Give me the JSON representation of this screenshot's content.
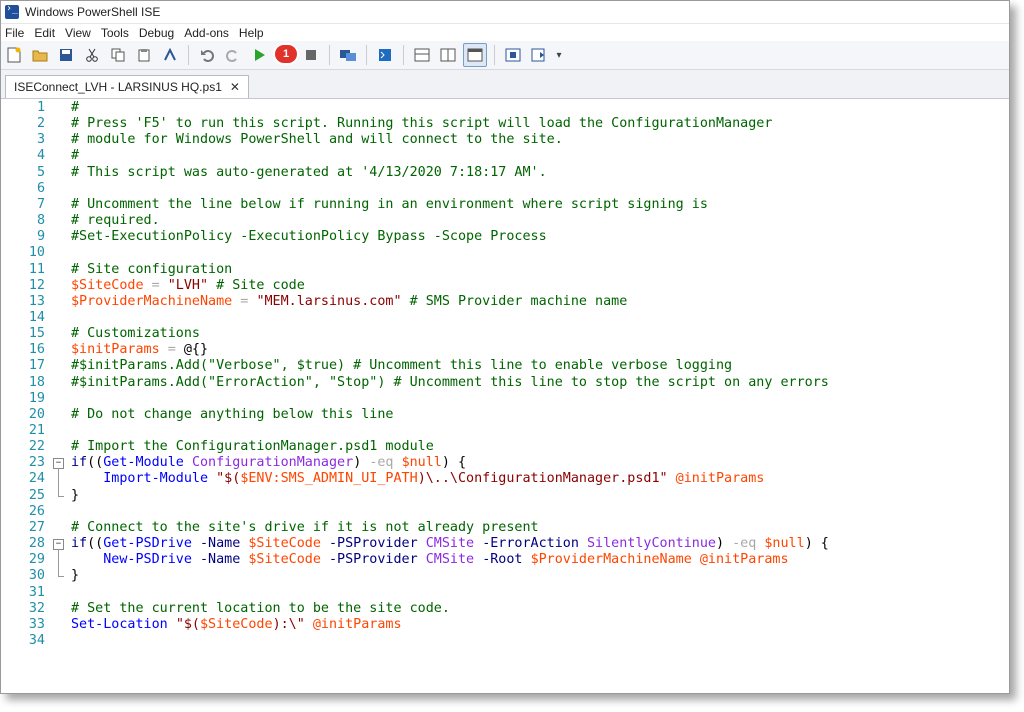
{
  "window": {
    "title": "Windows PowerShell ISE"
  },
  "menu": [
    "File",
    "Edit",
    "View",
    "Tools",
    "Debug",
    "Add-ons",
    "Help"
  ],
  "toolbar": {
    "icons": [
      "new-file-icon",
      "open-folder-icon",
      "save-icon",
      "cut-icon",
      "copy-icon",
      "paste-icon",
      "clear-icon",
      "undo-icon",
      "redo-icon",
      "run-script-icon",
      "run-selection-icon",
      "stop-icon",
      "remote-powershell-icon",
      "console-icon",
      "show-script-top-icon",
      "show-script-right-icon",
      "show-script-max-icon",
      "show-addon-icon",
      "show-addon-tools-icon"
    ],
    "badge": "1"
  },
  "tab": {
    "label": "ISEConnect_LVH - LARSINUS HQ.ps1",
    "close": "✕"
  },
  "code_lines": [
    [
      [
        "c-comment",
        "#"
      ]
    ],
    [
      [
        "c-comment",
        "# Press 'F5' to run this script. Running this script will load the ConfigurationManager"
      ]
    ],
    [
      [
        "c-comment",
        "# module for Windows PowerShell and will connect to the site."
      ]
    ],
    [
      [
        "c-comment",
        "#"
      ]
    ],
    [
      [
        "c-comment",
        "# This script was auto-generated at '4/13/2020 7:18:17 AM'."
      ]
    ],
    [],
    [
      [
        "c-comment",
        "# Uncomment the line below if running in an environment where script signing is"
      ]
    ],
    [
      [
        "c-comment",
        "# required."
      ]
    ],
    [
      [
        "c-comment",
        "#Set-ExecutionPolicy -ExecutionPolicy Bypass -Scope Process"
      ]
    ],
    [],
    [
      [
        "c-comment",
        "# Site configuration"
      ]
    ],
    [
      [
        "c-var",
        "$SiteCode"
      ],
      [
        "c-op",
        " = "
      ],
      [
        "c-str",
        "\"LVH\""
      ],
      [
        "c-comment",
        " # Site code"
      ]
    ],
    [
      [
        "c-var",
        "$ProviderMachineName"
      ],
      [
        "c-op",
        " = "
      ],
      [
        "c-str",
        "\"MEM.larsinus.com\""
      ],
      [
        "c-comment",
        " # SMS Provider machine name"
      ]
    ],
    [],
    [
      [
        "c-comment",
        "# Customizations"
      ]
    ],
    [
      [
        "c-var",
        "$initParams"
      ],
      [
        "c-op",
        " = "
      ],
      [
        "c-plain",
        "@{}"
      ]
    ],
    [
      [
        "c-comment",
        "#$initParams.Add(\"Verbose\", $true) # Uncomment this line to enable verbose logging"
      ]
    ],
    [
      [
        "c-comment",
        "#$initParams.Add(\"ErrorAction\", \"Stop\") # Uncomment this line to stop the script on any errors"
      ]
    ],
    [],
    [
      [
        "c-comment",
        "# Do not change anything below this line"
      ]
    ],
    [],
    [
      [
        "c-comment",
        "# Import the ConfigurationManager.psd1 module"
      ]
    ],
    [
      [
        "c-kw",
        "if"
      ],
      [
        "c-plain",
        "(("
      ],
      [
        "c-cmd",
        "Get-Module"
      ],
      [
        "c-plain",
        " "
      ],
      [
        "c-type",
        "ConfigurationManager"
      ],
      [
        "c-plain",
        ") "
      ],
      [
        "c-op",
        "-eq"
      ],
      [
        "c-plain",
        " "
      ],
      [
        "c-var",
        "$null"
      ],
      [
        "c-plain",
        ") {"
      ]
    ],
    [
      [
        "c-plain",
        "    "
      ],
      [
        "c-cmd",
        "Import-Module"
      ],
      [
        "c-plain",
        " "
      ],
      [
        "c-str",
        "\"$("
      ],
      [
        "c-var",
        "$ENV:SMS_ADMIN_UI_PATH"
      ],
      [
        "c-str",
        ")\\..\\ConfigurationManager.psd1\""
      ],
      [
        "c-plain",
        " "
      ],
      [
        "c-var",
        "@initParams"
      ]
    ],
    [
      [
        "c-plain",
        "}"
      ]
    ],
    [],
    [
      [
        "c-comment",
        "# Connect to the site's drive if it is not already present"
      ]
    ],
    [
      [
        "c-kw",
        "if"
      ],
      [
        "c-plain",
        "(("
      ],
      [
        "c-cmd",
        "Get-PSDrive"
      ],
      [
        "c-plain",
        " "
      ],
      [
        "c-param",
        "-Name"
      ],
      [
        "c-plain",
        " "
      ],
      [
        "c-var",
        "$SiteCode"
      ],
      [
        "c-plain",
        " "
      ],
      [
        "c-param",
        "-PSProvider"
      ],
      [
        "c-plain",
        " "
      ],
      [
        "c-type",
        "CMSite"
      ],
      [
        "c-plain",
        " "
      ],
      [
        "c-param",
        "-ErrorAction"
      ],
      [
        "c-plain",
        " "
      ],
      [
        "c-type",
        "SilentlyContinue"
      ],
      [
        "c-plain",
        ") "
      ],
      [
        "c-op",
        "-eq"
      ],
      [
        "c-plain",
        " "
      ],
      [
        "c-var",
        "$null"
      ],
      [
        "c-plain",
        ") {"
      ]
    ],
    [
      [
        "c-plain",
        "    "
      ],
      [
        "c-cmd",
        "New-PSDrive"
      ],
      [
        "c-plain",
        " "
      ],
      [
        "c-param",
        "-Name"
      ],
      [
        "c-plain",
        " "
      ],
      [
        "c-var",
        "$SiteCode"
      ],
      [
        "c-plain",
        " "
      ],
      [
        "c-param",
        "-PSProvider"
      ],
      [
        "c-plain",
        " "
      ],
      [
        "c-type",
        "CMSite"
      ],
      [
        "c-plain",
        " "
      ],
      [
        "c-param",
        "-Root"
      ],
      [
        "c-plain",
        " "
      ],
      [
        "c-var",
        "$ProviderMachineName"
      ],
      [
        "c-plain",
        " "
      ],
      [
        "c-var",
        "@initParams"
      ]
    ],
    [
      [
        "c-plain",
        "}"
      ]
    ],
    [],
    [
      [
        "c-comment",
        "# Set the current location to be the site code."
      ]
    ],
    [
      [
        "c-cmd",
        "Set-Location"
      ],
      [
        "c-plain",
        " "
      ],
      [
        "c-str",
        "\"$("
      ],
      [
        "c-var",
        "$SiteCode"
      ],
      [
        "c-str",
        "):\\\""
      ],
      [
        "c-plain",
        " "
      ],
      [
        "c-var",
        "@initParams"
      ]
    ],
    []
  ]
}
